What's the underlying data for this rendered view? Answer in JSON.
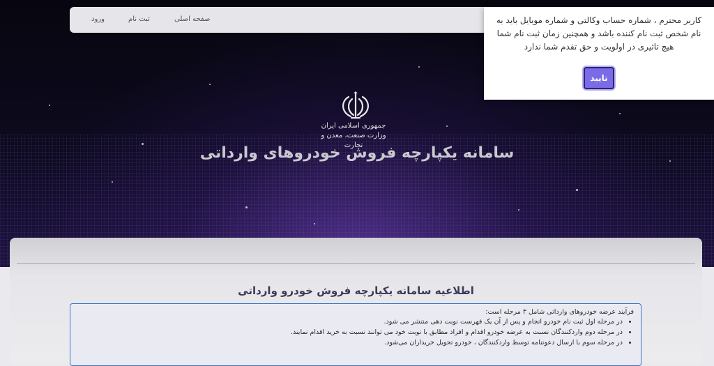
{
  "nav": {
    "home_label": "صفحه اصلی",
    "register_label": "ثبت نام",
    "login_label": "ورود"
  },
  "hero": {
    "emblem_icon": "iran-emblem-icon",
    "ministry_line1": "جمهوری اسلامی ایران",
    "ministry_line2": "وزارت صنعت، معدن و تجارت",
    "title": "سامانه یکپارچه فروش خودروهای وارداتی"
  },
  "notice": {
    "title": "اطلاعیه سامانه یکپارچه فروش خودرو وارداتی",
    "intro": "فرآیند عرضه خودروهای وارداتی شامل ۳ مرحله است:",
    "items": [
      "در مرحله اول ثبت نام خودرو انجام و پس از آن یک فهرست نوبت دهی منتشر می شود.",
      "در مرحله دوم واردکنندگان نسبت به عرضه خودرو اقدام و افراد مطابق با نوبت خود می توانند نسبت به خرید اقدام نمایند.",
      "در مرحله سوم با ارسال دعوتنامه توسط واردکنندگان ، خودرو تحویل خریداران می‌شود."
    ]
  },
  "modal": {
    "message": "کاربر محترم ، شماره حساب وکالتی و شماره موبایل باید به نام شخص ثبت نام کننده باشد و همچنین زمان ثبت نام شما هیچ تاثیری در اولویت و حق تقدم شما ندارد",
    "confirm_label": "تایید"
  },
  "colors": {
    "confirm_button": "#7b6be6",
    "notice_border": "#3c74c8",
    "hero_background": "#0d0a1e"
  }
}
